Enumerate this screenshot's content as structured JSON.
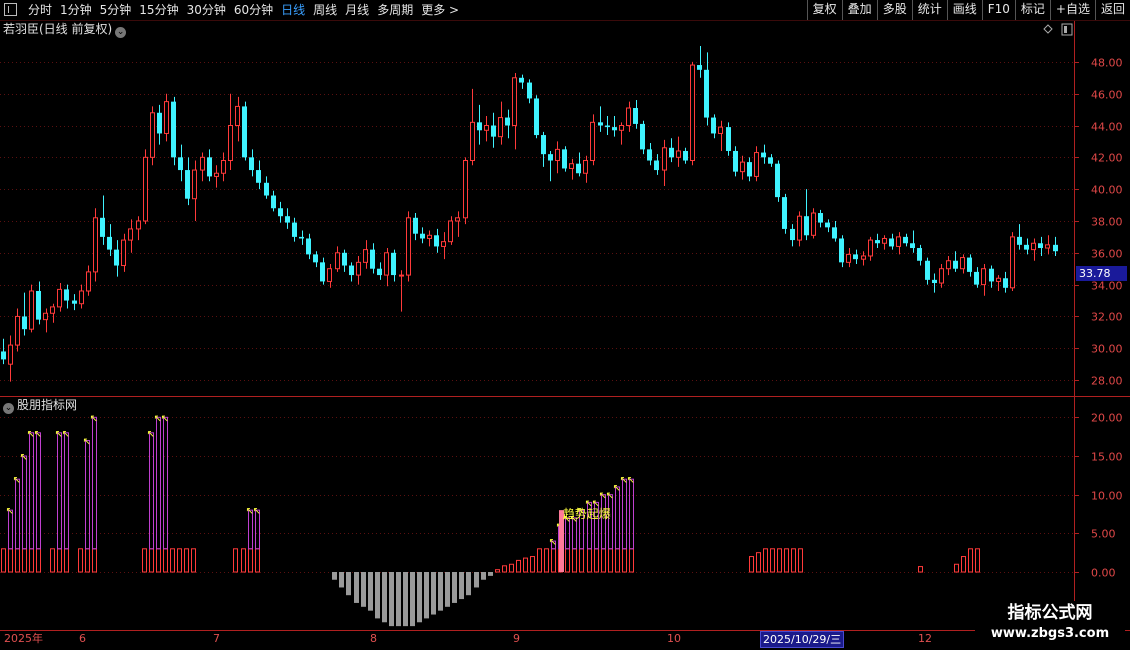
{
  "toolbar": {
    "periods": [
      "分时",
      "1分钟",
      "5分钟",
      "15分钟",
      "30分钟",
      "60分钟",
      "日线",
      "周线",
      "月线",
      "多周期",
      "更多 >"
    ],
    "active_period": "日线",
    "tools": [
      "复权",
      "叠加",
      "多股",
      "统计",
      "画线",
      "F10",
      "标记",
      "+自选",
      "返回"
    ]
  },
  "main_panel": {
    "title": "若羽臣(日线 前复权)",
    "current_price_tag": "33.78",
    "y_ticks": [
      "48.00",
      "46.00",
      "44.00",
      "42.00",
      "40.00",
      "38.00",
      "36.00",
      "34.00",
      "32.00",
      "30.00",
      "28.00"
    ]
  },
  "sub_panel": {
    "title": "股朋指标网",
    "signal_label": "趋势起爆",
    "y_ticks": [
      "20.00",
      "15.00",
      "10.00",
      "5.00",
      "0.00"
    ]
  },
  "date_axis": {
    "labels": [
      "2025年",
      "6",
      "7",
      "8",
      "9",
      "10",
      "2025/10/29/三",
      "12"
    ],
    "highlight": "2025/10/29/三"
  },
  "watermark": {
    "title": "指标公式网",
    "url": "www.zbgs3.com"
  },
  "colors": {
    "up": "#ff3a3a",
    "down": "#3ff3ff",
    "grid": "#5a1010",
    "neg_bar": "#9a9a9a",
    "signal_bar": "#ff7a9a",
    "level_bar": "#c040d0",
    "marker": "#ffff40"
  },
  "chart_data": {
    "type": "candlestick",
    "ylim": [
      27,
      49.5
    ],
    "ohlc": [
      [
        29.8,
        30.6,
        29.0,
        29.3
      ],
      [
        29.0,
        30.8,
        27.9,
        30.2
      ],
      [
        30.2,
        32.5,
        29.8,
        32.0
      ],
      [
        32.0,
        33.5,
        30.8,
        31.2
      ],
      [
        31.2,
        34.0,
        31.0,
        33.6
      ],
      [
        33.6,
        34.2,
        31.5,
        31.8
      ],
      [
        31.8,
        32.5,
        31.0,
        32.2
      ],
      [
        32.2,
        32.8,
        31.6,
        32.6
      ],
      [
        32.6,
        34.1,
        32.3,
        33.7
      ],
      [
        33.7,
        34.0,
        32.5,
        33.0
      ],
      [
        33.0,
        33.4,
        32.4,
        32.8
      ],
      [
        32.8,
        34.0,
        32.5,
        33.6
      ],
      [
        33.6,
        35.2,
        33.3,
        34.8
      ],
      [
        34.8,
        38.8,
        34.2,
        38.2
      ],
      [
        38.2,
        39.6,
        36.5,
        37.0
      ],
      [
        37.0,
        37.8,
        35.8,
        36.2
      ],
      [
        36.2,
        36.8,
        34.5,
        35.2
      ],
      [
        35.2,
        37.2,
        34.8,
        36.8
      ],
      [
        36.8,
        38.1,
        36.0,
        37.5
      ],
      [
        37.5,
        38.3,
        36.8,
        38.0
      ],
      [
        38.0,
        42.5,
        37.8,
        42.0
      ],
      [
        42.0,
        45.2,
        41.5,
        44.8
      ],
      [
        44.8,
        45.3,
        42.8,
        43.5
      ],
      [
        43.5,
        46.0,
        43.0,
        45.5
      ],
      [
        45.5,
        45.8,
        41.5,
        42.0
      ],
      [
        42.0,
        42.8,
        40.5,
        41.2
      ],
      [
        41.2,
        42.0,
        39.0,
        39.4
      ],
      [
        39.4,
        41.8,
        38.0,
        41.2
      ],
      [
        41.2,
        42.3,
        40.5,
        42.0
      ],
      [
        42.0,
        42.5,
        40.5,
        40.8
      ],
      [
        40.8,
        41.5,
        40.1,
        41.0
      ],
      [
        41.0,
        42.3,
        40.5,
        41.8
      ],
      [
        41.8,
        46.0,
        41.2,
        44.0
      ],
      [
        44.0,
        45.8,
        43.0,
        45.2
      ],
      [
        45.2,
        45.5,
        41.8,
        42.0
      ],
      [
        42.0,
        42.5,
        40.8,
        41.2
      ],
      [
        41.2,
        41.8,
        40.0,
        40.4
      ],
      [
        40.4,
        40.8,
        39.4,
        39.6
      ],
      [
        39.6,
        39.9,
        38.6,
        38.8
      ],
      [
        38.8,
        39.2,
        37.9,
        38.3
      ],
      [
        38.3,
        38.8,
        37.5,
        37.9
      ],
      [
        37.9,
        38.2,
        36.7,
        37.0
      ],
      [
        37.0,
        37.4,
        36.5,
        36.9
      ],
      [
        36.9,
        37.2,
        35.6,
        35.9
      ],
      [
        35.9,
        36.1,
        35.1,
        35.4
      ],
      [
        35.4,
        35.7,
        34.0,
        34.2
      ],
      [
        34.2,
        35.3,
        33.8,
        35.0
      ],
      [
        35.0,
        36.4,
        34.8,
        36.0
      ],
      [
        36.0,
        36.2,
        34.8,
        35.2
      ],
      [
        35.2,
        35.4,
        34.2,
        34.6
      ],
      [
        34.6,
        35.8,
        34.0,
        35.4
      ],
      [
        35.4,
        36.8,
        35.0,
        36.2
      ],
      [
        36.2,
        36.6,
        34.7,
        35.0
      ],
      [
        35.0,
        35.4,
        34.3,
        34.6
      ],
      [
        34.6,
        36.3,
        33.9,
        36.0
      ],
      [
        36.0,
        36.2,
        34.2,
        34.6
      ],
      [
        34.6,
        34.9,
        32.3,
        34.6
      ],
      [
        34.6,
        38.6,
        34.2,
        38.2
      ],
      [
        38.2,
        38.5,
        36.8,
        37.2
      ],
      [
        37.2,
        37.6,
        36.6,
        36.9
      ],
      [
        36.9,
        37.4,
        36.4,
        37.1
      ],
      [
        37.1,
        37.5,
        36.0,
        36.4
      ],
      [
        36.4,
        37.3,
        35.6,
        36.7
      ],
      [
        36.7,
        38.3,
        36.5,
        38.0
      ],
      [
        38.0,
        38.6,
        37.0,
        38.2
      ],
      [
        38.2,
        42.0,
        37.8,
        41.8
      ],
      [
        41.8,
        46.3,
        41.5,
        44.2
      ],
      [
        44.2,
        45.3,
        42.8,
        43.7
      ],
      [
        43.7,
        44.6,
        43.0,
        44.0
      ],
      [
        44.0,
        44.8,
        42.6,
        43.3
      ],
      [
        43.3,
        45.5,
        42.8,
        44.5
      ],
      [
        44.5,
        45.0,
        43.2,
        44.0
      ],
      [
        44.0,
        47.3,
        42.5,
        47.0
      ],
      [
        47.0,
        47.2,
        46.3,
        46.7
      ],
      [
        46.7,
        46.9,
        45.4,
        45.7
      ],
      [
        45.7,
        45.9,
        43.2,
        43.4
      ],
      [
        43.4,
        43.6,
        41.4,
        42.2
      ],
      [
        42.2,
        42.4,
        40.5,
        41.8
      ],
      [
        41.8,
        43.0,
        41.0,
        42.5
      ],
      [
        42.5,
        42.7,
        41.1,
        41.3
      ],
      [
        41.3,
        41.9,
        40.6,
        41.6
      ],
      [
        41.6,
        42.3,
        40.8,
        41.0
      ],
      [
        41.0,
        42.1,
        40.4,
        41.8
      ],
      [
        41.8,
        44.7,
        41.5,
        44.2
      ],
      [
        44.2,
        45.2,
        43.6,
        44.0
      ],
      [
        44.0,
        44.6,
        43.4,
        43.9
      ],
      [
        43.9,
        44.6,
        43.3,
        43.7
      ],
      [
        43.7,
        44.2,
        42.8,
        44.0
      ],
      [
        44.0,
        45.5,
        43.6,
        45.1
      ],
      [
        45.1,
        45.6,
        43.8,
        44.1
      ],
      [
        44.1,
        44.3,
        42.2,
        42.5
      ],
      [
        42.5,
        42.9,
        41.5,
        41.8
      ],
      [
        41.8,
        42.2,
        40.9,
        41.2
      ],
      [
        41.2,
        43.1,
        40.2,
        42.6
      ],
      [
        42.6,
        43.2,
        41.7,
        42.0
      ],
      [
        42.0,
        43.3,
        41.4,
        42.4
      ],
      [
        42.4,
        42.6,
        41.6,
        41.8
      ],
      [
        41.8,
        48.0,
        41.5,
        47.8
      ],
      [
        47.8,
        49.0,
        47.0,
        47.5
      ],
      [
        47.5,
        48.6,
        44.0,
        44.5
      ],
      [
        44.5,
        44.7,
        43.2,
        43.5
      ],
      [
        43.5,
        44.3,
        42.4,
        43.9
      ],
      [
        43.9,
        44.2,
        42.1,
        42.4
      ],
      [
        42.4,
        42.7,
        40.8,
        41.1
      ],
      [
        41.1,
        42.1,
        40.6,
        41.7
      ],
      [
        41.7,
        42.0,
        40.5,
        40.8
      ],
      [
        40.8,
        42.7,
        40.5,
        42.3
      ],
      [
        42.3,
        42.8,
        41.6,
        42.0
      ],
      [
        42.0,
        42.2,
        41.4,
        41.6
      ],
      [
        41.6,
        41.8,
        39.2,
        39.5
      ],
      [
        39.5,
        39.7,
        37.2,
        37.5
      ],
      [
        37.5,
        37.8,
        36.4,
        36.8
      ],
      [
        36.8,
        38.6,
        36.4,
        38.3
      ],
      [
        38.3,
        40.0,
        36.8,
        37.1
      ],
      [
        37.1,
        38.8,
        36.9,
        38.5
      ],
      [
        38.5,
        38.7,
        37.6,
        37.9
      ],
      [
        37.9,
        38.1,
        37.3,
        37.6
      ],
      [
        37.6,
        38.0,
        36.7,
        36.9
      ],
      [
        36.9,
        37.1,
        35.1,
        35.4
      ],
      [
        35.4,
        36.3,
        35.1,
        35.9
      ],
      [
        35.9,
        36.2,
        35.3,
        35.6
      ],
      [
        35.6,
        36.1,
        35.2,
        35.8
      ],
      [
        35.8,
        37.0,
        35.5,
        36.8
      ],
      [
        36.8,
        37.2,
        36.3,
        36.6
      ],
      [
        36.6,
        37.1,
        36.2,
        36.9
      ],
      [
        36.9,
        37.2,
        36.2,
        36.4
      ],
      [
        36.4,
        37.3,
        35.9,
        37.0
      ],
      [
        37.0,
        37.2,
        36.4,
        36.6
      ],
      [
        36.6,
        37.4,
        36.0,
        36.3
      ],
      [
        36.3,
        36.5,
        35.2,
        35.5
      ],
      [
        35.5,
        35.7,
        34.0,
        34.3
      ],
      [
        34.3,
        34.7,
        33.5,
        34.1
      ],
      [
        34.1,
        35.3,
        33.8,
        35.0
      ],
      [
        35.0,
        35.8,
        34.6,
        35.5
      ],
      [
        35.5,
        36.1,
        34.8,
        35.0
      ],
      [
        35.0,
        35.9,
        34.7,
        35.7
      ],
      [
        35.7,
        35.9,
        34.5,
        34.8
      ],
      [
        34.8,
        35.1,
        33.8,
        34.0
      ],
      [
        34.0,
        35.3,
        33.3,
        35.0
      ],
      [
        35.0,
        35.2,
        33.8,
        34.2
      ],
      [
        34.2,
        34.6,
        33.6,
        34.4
      ],
      [
        34.4,
        34.8,
        33.5,
        33.8
      ],
      [
        33.8,
        37.3,
        33.6,
        37.0
      ],
      [
        37.0,
        37.8,
        36.2,
        36.5
      ],
      [
        36.5,
        36.9,
        35.9,
        36.2
      ],
      [
        36.2,
        36.9,
        35.5,
        36.6
      ],
      [
        36.6,
        37.0,
        35.8,
        36.3
      ],
      [
        36.3,
        37.1,
        35.9,
        36.5
      ],
      [
        36.5,
        37.0,
        35.8,
        36.1
      ]
    ],
    "indicator": {
      "ylim": [
        -7.5,
        22.5
      ],
      "values": [
        3,
        8,
        12,
        15,
        18,
        18,
        0,
        3,
        18,
        18,
        0,
        3,
        17,
        20,
        0,
        0,
        0,
        0,
        0,
        0,
        3,
        18,
        20,
        20,
        3,
        3,
        3,
        3,
        0,
        0,
        0,
        0,
        0,
        3,
        3,
        8,
        8,
        0,
        0,
        0,
        0,
        0,
        0,
        0,
        0,
        0,
        0,
        -1,
        -2,
        -3,
        -4,
        -4.5,
        -5,
        -6,
        -6.5,
        -7,
        -7,
        -7,
        -7,
        -6.5,
        -6,
        -5.5,
        -5,
        -4.5,
        -4,
        -3.5,
        -3,
        -2,
        -1,
        -0.5,
        0.3,
        0.8,
        1,
        1.5,
        1.8,
        2,
        3,
        3,
        4,
        6,
        7,
        7,
        8,
        9,
        9,
        10,
        10,
        11,
        12,
        12,
        0,
        0,
        0,
        0,
        0,
        0,
        0,
        0,
        0,
        0,
        0,
        0,
        0,
        0,
        0,
        0,
        2,
        2.5,
        3,
        3,
        3,
        3,
        3,
        3,
        0,
        0,
        0,
        0,
        0,
        0,
        0,
        0,
        0,
        0,
        0,
        0,
        0,
        0,
        0,
        0,
        0.7,
        0,
        0,
        0,
        0,
        1,
        2,
        3,
        3,
        0,
        0,
        0,
        0,
        0,
        0,
        0,
        0,
        0,
        0,
        0
      ]
    }
  }
}
